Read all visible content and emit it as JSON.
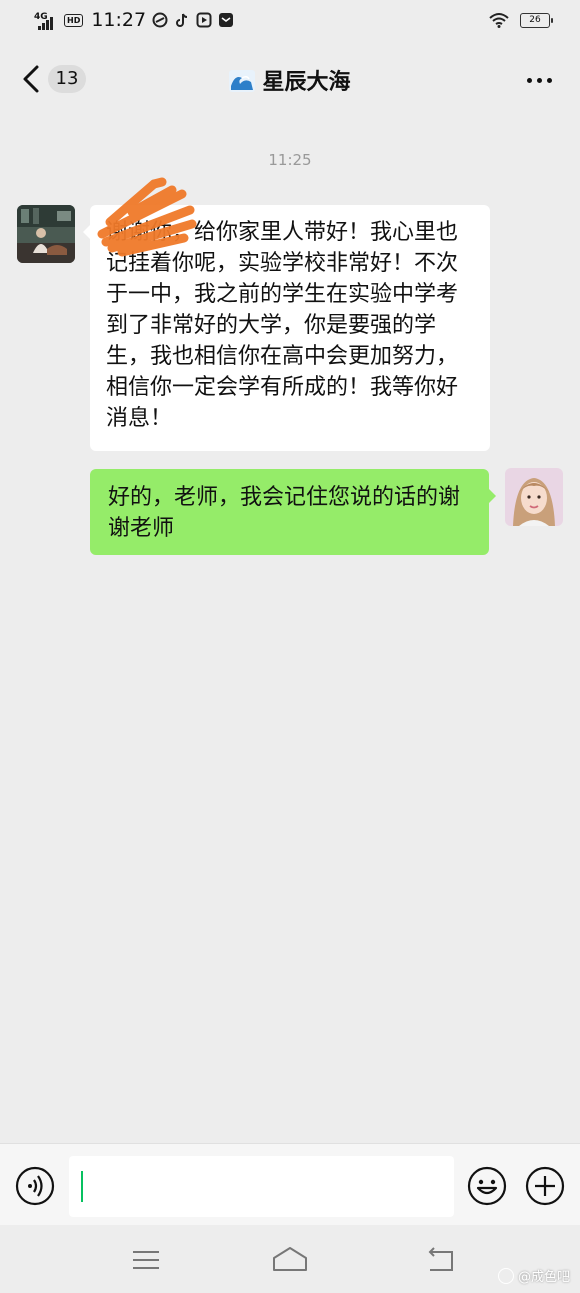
{
  "status_bar": {
    "network": "4G",
    "hd": "HD",
    "time": "11:27",
    "battery": "26"
  },
  "nav": {
    "unread_count": "13",
    "title": "星辰大海",
    "title_emoji": "wave-emoji"
  },
  "chat": {
    "timestamp": "11:25",
    "messages": [
      {
        "side": "left",
        "text": "谢谢你，给你家里人带好！我心里也记挂着你呢，实验学校非常好！不次于一中，我之前的学生在实验中学考到了非常好的大学，你是要强的学生，我也相信你在高中会更加努力，相信你一定会学有所成的！我等你好消息！"
      },
      {
        "side": "right",
        "text": "好的，老师，我会记住您说的话的谢谢老师"
      }
    ]
  },
  "watermark": "@成色吧",
  "colors": {
    "background": "#ededed",
    "bubble_right": "#95ec69",
    "bubble_left": "#ffffff",
    "caret": "#07c160",
    "scribble": "#f07a2a"
  }
}
